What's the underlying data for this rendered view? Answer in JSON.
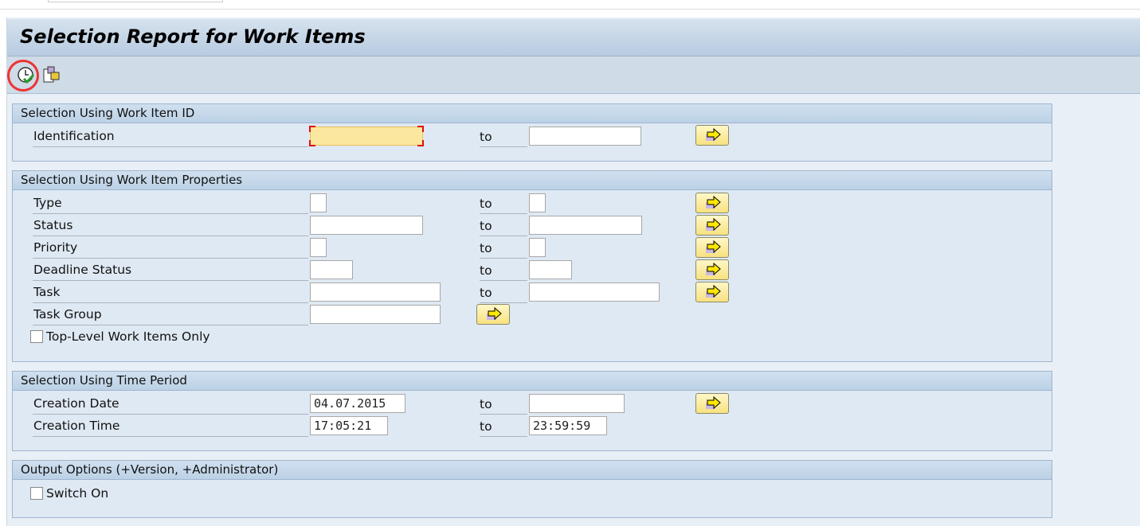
{
  "title": "Selection Report for Work Items",
  "toolbar": {
    "icons": [
      "execute-clock-check-icon",
      "multiple-selection-icon"
    ]
  },
  "groups": {
    "work_item_id": {
      "title": "Selection Using Work Item ID",
      "identification": "Identification"
    },
    "properties": {
      "title": "Selection Using Work Item Properties",
      "type": "Type",
      "status": "Status",
      "priority": "Priority",
      "deadline_status": "Deadline Status",
      "task": "Task",
      "task_group": "Task Group",
      "top_level": "Top-Level Work Items Only"
    },
    "time": {
      "title": "Selection Using Time Period",
      "creation_date": "Creation Date",
      "creation_date_from": "04.07.2015",
      "creation_date_to": "",
      "creation_time": "Creation Time",
      "creation_time_from": "17:05:21",
      "creation_time_to": "23:59:59"
    },
    "output": {
      "title": "Output Options (+Version, +Administrator)",
      "switch_on": "Switch On"
    }
  },
  "to_label": "to"
}
